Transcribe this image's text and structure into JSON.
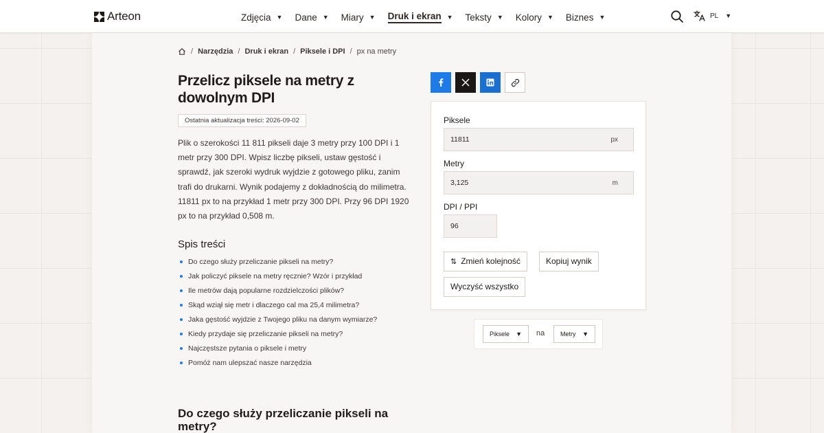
{
  "header": {
    "logo_text": "Arteon",
    "nav": [
      {
        "label": "Zdjęcia"
      },
      {
        "label": "Dane"
      },
      {
        "label": "Miary"
      },
      {
        "label": "Druk i ekran",
        "active": true
      },
      {
        "label": "Teksty"
      },
      {
        "label": "Kolory"
      },
      {
        "label": "Biznes"
      }
    ],
    "language": "PL"
  },
  "breadcrumb": {
    "items": [
      "Narzędzia",
      "Druk i ekran",
      "Piksele i DPI"
    ],
    "current": "px na metry"
  },
  "page": {
    "title": "Przelicz piksele na metry z dowolnym DPI",
    "updated": "Ostatnia aktualizacja treści: 2026-09-02",
    "intro": "Plik o szerokości 11 811 pikseli daje 3 metry przy 100 DPI i 1 metr przy 300 DPI. Wpisz liczbę pikseli, ustaw gęstość i sprawdź, jak szeroki wydruk wyjdzie z gotowego pliku, zanim trafi do drukarni. Wynik podajemy z dokładnością do milimetra. 11811 px to na przykład 1 metr przy 300 DPI. Przy 96 DPI 1920 px to na przykład 0,508 m.",
    "toc_title": "Spis treści",
    "toc": [
      "Do czego służy przeliczanie pikseli na metry?",
      "Jak policzyć piksele na metry ręcznie? Wzór i przykład",
      "Ile metrów dają popularne rozdzielczości plików?",
      "Skąd wziął się metr i dlaczego cal ma 25,4 milimetra?",
      "Jaka gęstość wyjdzie z Twojego pliku na danym wymiarze?",
      "Kiedy przydaje się przeliczanie pikseli na metry?",
      "Najczęstsze pytania o piksele i metry",
      "Pomóż nam ulepszać nasze narzędzia"
    ],
    "section_title": "Do czego służy przeliczanie pikseli na metry?"
  },
  "share": {
    "icons": [
      "facebook-icon",
      "x-icon",
      "linkedin-icon",
      "link-icon"
    ]
  },
  "converter": {
    "pixels_label": "Piksele",
    "pixels_value": "11811",
    "pixels_unit": "px",
    "meters_label": "Metry",
    "meters_value": "3,125",
    "meters_unit": "m",
    "dpi_label": "DPI / PPI",
    "dpi_value": "96",
    "swap_label": "Zmień kolejność",
    "copy_label": "Kopiuj wynik",
    "clear_label": "Wyczyść wszystko"
  },
  "unit_selector": {
    "from": "Piksele",
    "connector": "na",
    "to": "Metry"
  },
  "colors": {
    "accent": "#1e7ae6",
    "facebook": "#1e7ae6",
    "x": "#1a1716",
    "linkedin": "#1b6fd0",
    "text": "#1f1c1a",
    "background": "#f4f1ee"
  }
}
